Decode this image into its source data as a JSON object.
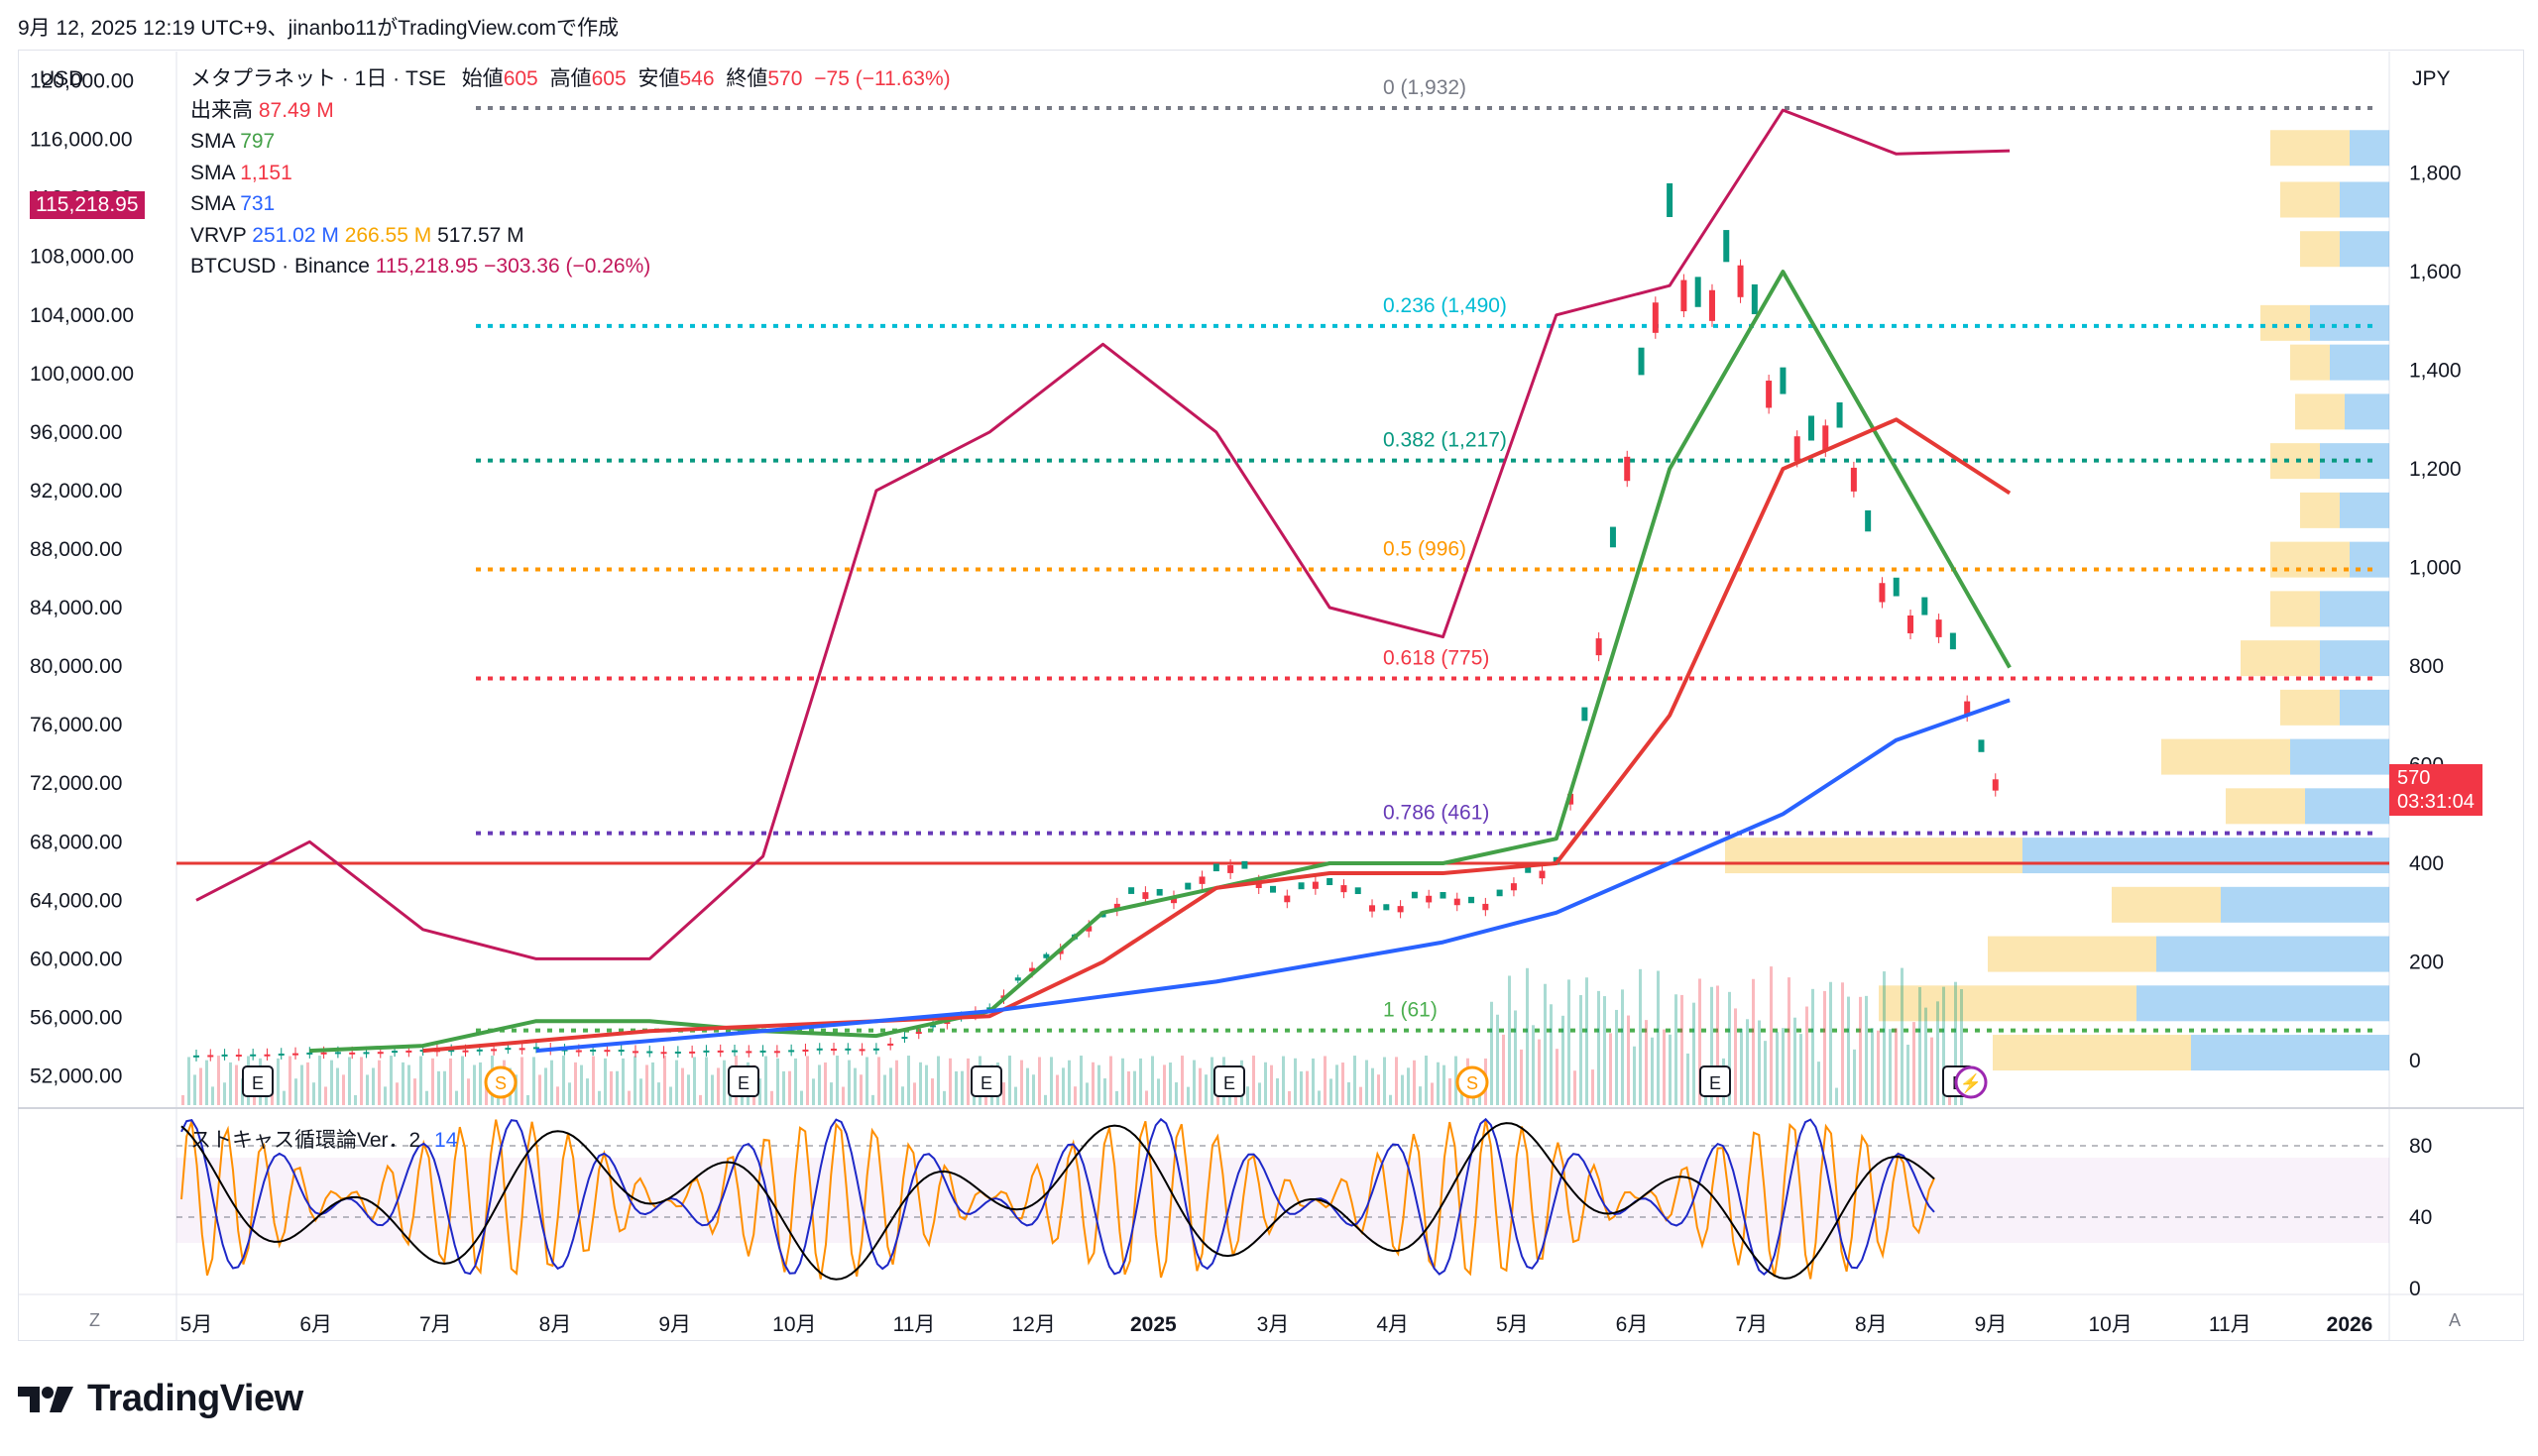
{
  "header": {
    "text": "9月 12, 2025 12:19 UTC+9、jinanbo11がTradingView.comで作成"
  },
  "logo": {
    "text": "TradingView"
  },
  "legend": {
    "symbol": "メタプラネット · 1日 · TSE",
    "open_label": "始値",
    "open": "605",
    "high_label": "高値",
    "high": "605",
    "low_label": "安値",
    "low": "546",
    "close_label": "終値",
    "close": "570",
    "change": "−75 (−11.63%)",
    "volume_label": "出来高",
    "volume": "87.49 M",
    "sma1_label": "SMA",
    "sma1": "797",
    "sma2_label": "SMA",
    "sma2": "1,151",
    "sma3_label": "SMA",
    "sma3": "731",
    "vrvp_label": "VRVP",
    "vrvp1": "251.02 M",
    "vrvp2": "266.55 M",
    "vrvp3": "517.57 M",
    "btc_label": "BTCUSD · Binance",
    "btc_price": "115,218.95",
    "btc_change": "−303.36 (−0.26%)"
  },
  "axes": {
    "left_currency": "USD",
    "right_currency": "JPY",
    "btc_price_tag": "115,218.95",
    "last_price_tag": "570",
    "countdown": "03:31:04",
    "left_ticks": [
      "120,000.00",
      "116,000.00",
      "112,000.00",
      "108,000.00",
      "104,000.00",
      "100,000.00",
      "96,000.00",
      "92,000.00",
      "88,000.00",
      "84,000.00",
      "80,000.00",
      "76,000.00",
      "72,000.00",
      "68,000.00",
      "64,000.00",
      "60,000.00",
      "56,000.00",
      "52,000.00"
    ],
    "right_ticks": [
      "1,800",
      "1,600",
      "1,400",
      "1,200",
      "1,000",
      "800",
      "600",
      "400",
      "200",
      "0"
    ],
    "osc_ticks": [
      "80",
      "40",
      "0"
    ],
    "time_ticks": [
      "5月",
      "6月",
      "7月",
      "8月",
      "9月",
      "10月",
      "11月",
      "12月",
      "2025",
      "3月",
      "4月",
      "5月",
      "6月",
      "7月",
      "8月",
      "9月",
      "10月",
      "11月",
      "2026"
    ],
    "z_button": "Z",
    "a_button": "A"
  },
  "fib_levels": [
    {
      "label": "0 (1,932)",
      "price": 1932,
      "color": "#787b86"
    },
    {
      "label": "0.236 (1,490)",
      "price": 1490,
      "color": "#00bcd4"
    },
    {
      "label": "0.382 (1,217)",
      "price": 1217,
      "color": "#089981"
    },
    {
      "label": "0.5 (996)",
      "price": 996,
      "color": "#ff9800"
    },
    {
      "label": "0.618 (775)",
      "price": 775,
      "color": "#f23645"
    },
    {
      "label": "0.786 (461)",
      "price": 461,
      "color": "#673ab7"
    },
    {
      "label": "1 (61)",
      "price": 61,
      "color": "#4caf50"
    }
  ],
  "oscillator": {
    "label": "ストキャス循環論Ver．2",
    "param": "14",
    "levels": [
      80,
      40,
      0
    ]
  },
  "event_markers": [
    "E",
    "S",
    "E",
    "E",
    "E",
    "S",
    "E",
    "E",
    "⚡"
  ],
  "colors": {
    "btc": "#c2185b",
    "sma_green": "#43a047",
    "sma_red": "#e53935",
    "sma_blue": "#2962ff",
    "up": "#089981",
    "down": "#f23645",
    "hline": "#e53935",
    "vp_yellow": "#f9c74f",
    "vp_blue": "#4aa3e8",
    "osc_orange": "#ff8f00",
    "osc_blue": "#1e28c8",
    "osc_black": "#000000"
  },
  "chart_data": {
    "type": "line",
    "title": "メタプラネット · 1日 · TSE",
    "x": [
      "2024-05",
      "2024-06",
      "2024-07",
      "2024-08",
      "2024-09",
      "2024-10",
      "2024-11",
      "2024-12",
      "2025-01",
      "2025-02",
      "2025-03",
      "2025-04",
      "2025-05",
      "2025-06",
      "2025-07",
      "2025-08",
      "2025-09",
      "2025-10",
      "2025-11",
      "2026-01"
    ],
    "series": [
      {
        "name": "メタプラネット",
        "axis": "JPY",
        "values": [
          10,
          15,
          20,
          25,
          18,
          20,
          25,
          110,
          300,
          380,
          340,
          310,
          380,
          1700,
          1400,
          1000,
          570,
          null,
          null,
          null
        ]
      },
      {
        "name": "BTCUSD · Binance",
        "axis": "USD",
        "values": [
          64000,
          68000,
          62000,
          60000,
          60000,
          67000,
          92000,
          96000,
          102000,
          96000,
          84000,
          82000,
          104000,
          106000,
          118000,
          115000,
          115218.95,
          null,
          null,
          null
        ]
      },
      {
        "name": "SMA",
        "axis": "JPY",
        "values": [
          null,
          20,
          30,
          80,
          80,
          60,
          50,
          100,
          300,
          350,
          400,
          400,
          450,
          1200,
          1600,
          1200,
          797,
          null,
          null,
          null
        ]
      },
      {
        "name": "SMA",
        "axis": "JPY",
        "values": [
          null,
          null,
          20,
          40,
          60,
          70,
          80,
          90,
          200,
          350,
          380,
          380,
          400,
          700,
          1200,
          1300,
          1151,
          null,
          null,
          null
        ]
      },
      {
        "name": "SMA",
        "axis": "JPY",
        "values": [
          null,
          null,
          null,
          20,
          40,
          60,
          80,
          100,
          130,
          160,
          200,
          240,
          300,
          400,
          500,
          650,
          731,
          null,
          null,
          null
        ]
      }
    ],
    "last_close": 570,
    "volume_last": "87.49 M",
    "y_left_range": [
      50000,
      122000
    ],
    "y_right_range": [
      0,
      1950
    ],
    "red_hline_price": 400
  }
}
